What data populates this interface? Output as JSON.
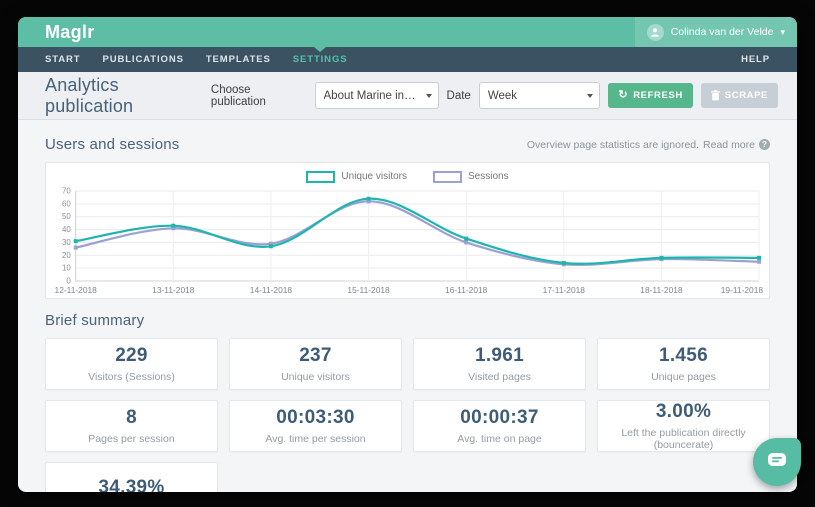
{
  "header": {
    "brand": "Maglr",
    "user_name": "Colinda van der Velde"
  },
  "nav": {
    "items": [
      "START",
      "PUBLICATIONS",
      "TEMPLATES",
      "SETTINGS"
    ],
    "active_index": 3,
    "help_label": "HELP"
  },
  "toolbar": {
    "title": "Analytics publication",
    "choose_publication_label": "Choose publication",
    "publication_value": "About Marine ingenuity -",
    "date_label": "Date",
    "date_value": "Week",
    "refresh_label": "REFRESH",
    "scrape_label": "SCRAPE"
  },
  "users_sessions": {
    "title": "Users and sessions",
    "note": "Overview page statistics are ignored.",
    "read_more_label": "Read more"
  },
  "chart_data": {
    "type": "line",
    "x": [
      "12-11-2018",
      "13-11-2018",
      "14-11-2018",
      "15-11-2018",
      "16-11-2018",
      "17-11-2018",
      "18-11-2018",
      "19-11-2018"
    ],
    "series": [
      {
        "name": "Unique visitors",
        "color": "#1fb5ad",
        "values": [
          31,
          43,
          27,
          64,
          33,
          14,
          18,
          18
        ]
      },
      {
        "name": "Sessions",
        "color": "#9aa2d2",
        "values": [
          26,
          41,
          29,
          62,
          30,
          13,
          17,
          15
        ]
      }
    ],
    "ylim": [
      0,
      70
    ],
    "yticks": [
      0,
      10,
      20,
      30,
      40,
      50,
      60,
      70
    ],
    "grid": true,
    "legend_position": "top-center"
  },
  "summary": {
    "title": "Brief summary",
    "cards": [
      {
        "value": "229",
        "label": "Visitors (Sessions)"
      },
      {
        "value": "237",
        "label": "Unique visitors"
      },
      {
        "value": "1.961",
        "label": "Visited pages"
      },
      {
        "value": "1.456",
        "label": "Unique pages"
      },
      {
        "value": "8",
        "label": "Pages per session"
      },
      {
        "value": "00:03:30",
        "label": "Avg. time per session"
      },
      {
        "value": "00:00:37",
        "label": "Avg. time on page"
      },
      {
        "value": "3.00%",
        "label": "Left the publication directly (bouncerate)"
      },
      {
        "value": "34.39%",
        "label": ""
      }
    ]
  },
  "colors": {
    "header_teal": "#5ebda5",
    "user_chip_teal": "#74c6b1",
    "nav_dark": "#3b5262",
    "nav_active": "#4fc3aa",
    "refresh_green": "#56b78d",
    "scrape_gray": "#c7cfd6",
    "heading_slate": "#46627b",
    "line_unique_visitors": "#1fb5ad",
    "line_sessions": "#9aa2d2",
    "launcher_teal": "#56bca4"
  }
}
